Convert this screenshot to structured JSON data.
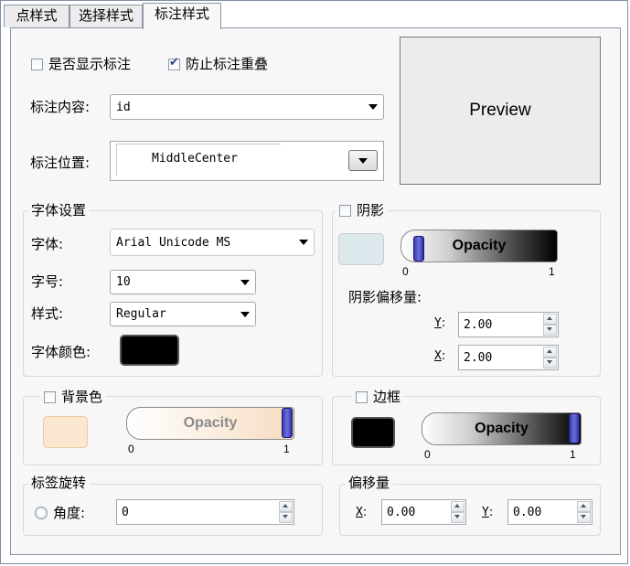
{
  "tabs": [
    "点样式",
    "选择样式",
    "标注样式"
  ],
  "label_section": {
    "show_label": "是否显示标注",
    "prevent_overlap": "防止标注重叠",
    "prevent_overlap_checked": true,
    "show_label_checked": false,
    "content_label": "标注内容:",
    "content_value": "id",
    "position_label": "标注位置:",
    "position_value": "MiddleCenter",
    "preview": "Preview"
  },
  "font_group": {
    "title": "字体设置",
    "font_label": "字体:",
    "font_value": "Arial Unicode MS",
    "size_label": "字号:",
    "size_value": "10",
    "style_label": "样式:",
    "style_value": "Regular",
    "color_label": "字体颜色:",
    "color": "#000000"
  },
  "shadow_group": {
    "title": "阴影",
    "checked": false,
    "color": "#dde9ed",
    "opacity_label": "Opacity",
    "opacity_value": 0,
    "min": "0",
    "max": "1",
    "offset_label": "阴影偏移量:",
    "y_label": "Y",
    "y_value": "2.00",
    "x_label": "X",
    "x_value": "2.00",
    "colon": ":"
  },
  "background_group": {
    "title": "背景色",
    "checked": false,
    "color": "#fbe6cf",
    "opacity_label": "Opacity",
    "opacity_value": 1,
    "min": "0",
    "max": "1"
  },
  "border_group": {
    "title": "边框",
    "checked": false,
    "color": "#000000",
    "opacity_label": "Opacity",
    "opacity_value": 1,
    "min": "0",
    "max": "1"
  },
  "rotation_group": {
    "title": "标签旋转",
    "angle_label": "角度:",
    "angle_value": "0"
  },
  "offset_group": {
    "title": "偏移量",
    "x_label": "X",
    "x_value": "0.00",
    "y_label": "Y",
    "y_value": "0.00",
    "colon": ":"
  }
}
